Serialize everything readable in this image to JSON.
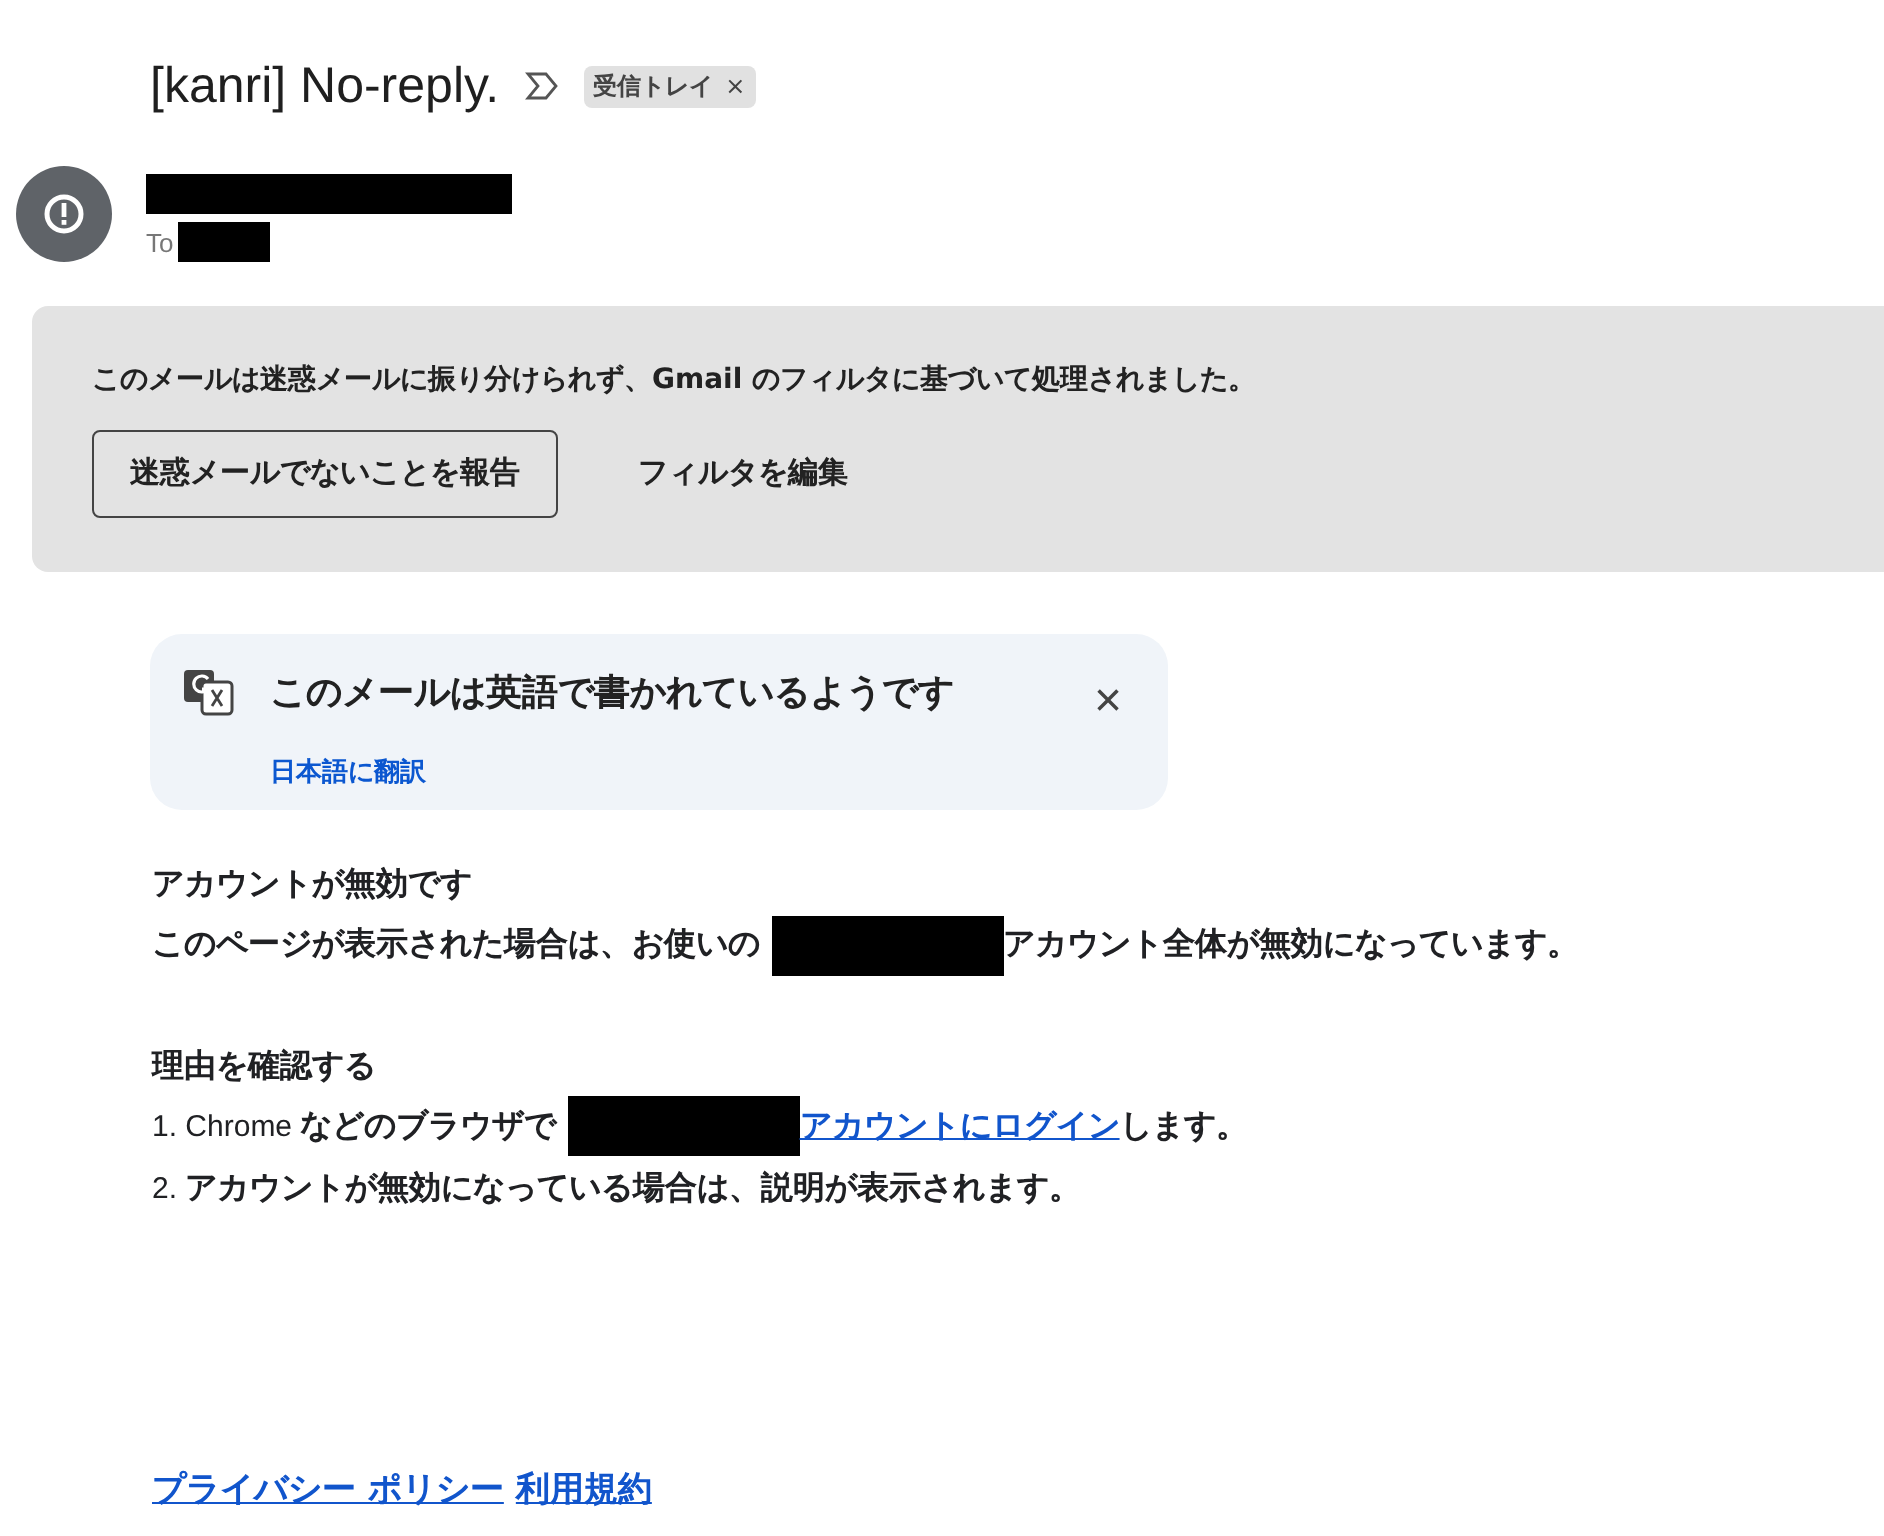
{
  "subject": "[kanri] No-reply.",
  "labels": [
    {
      "text": "受信トレイ"
    }
  ],
  "label_remove": "×",
  "sender": {
    "redacted": true,
    "to_label": "To",
    "to_redacted": true
  },
  "spam_notice": {
    "text": "このメールは迷惑メールに振り分けられず、Gmail のフィルタに基づいて処理されました。",
    "buttons": [
      {
        "label": "迷惑メールでないことを報告",
        "kind": "outlined"
      },
      {
        "label": "フィルタを編集",
        "kind": "text"
      }
    ]
  },
  "translate_card": {
    "text": "このメールは英語で書かれているようです",
    "action": "日本語に翻訳",
    "close": "×"
  },
  "body": [
    {
      "kind": "heading",
      "parts": [
        {
          "kind": "text",
          "text": "アカウントが無効です"
        }
      ]
    },
    {
      "kind": "para",
      "parts": [
        {
          "kind": "text",
          "text": "このページが表示された場合は、お使いの "
        },
        {
          "kind": "redaction"
        },
        {
          "kind": "text",
          "text": "アカウント全体が無効になっています。"
        }
      ]
    },
    {
      "kind": "gap"
    },
    {
      "kind": "heading",
      "parts": [
        {
          "kind": "text",
          "text": "理由を確認する"
        }
      ]
    },
    {
      "kind": "para",
      "parts": [
        {
          "kind": "small",
          "text": "1. Chrome "
        },
        {
          "kind": "text",
          "text": "などのブラウザで "
        },
        {
          "kind": "redaction"
        },
        {
          "kind": "link",
          "text": "アカウントにログイン"
        },
        {
          "kind": "text",
          "text": "します。"
        }
      ]
    },
    {
      "kind": "para",
      "parts": [
        {
          "kind": "small",
          "text": "2. "
        },
        {
          "kind": "text",
          "text": "アカウントが無効になっている場合は、説明が表示されます。"
        }
      ]
    }
  ],
  "footer_links": [
    "プライバシー ポリシー",
    "利用規約"
  ]
}
